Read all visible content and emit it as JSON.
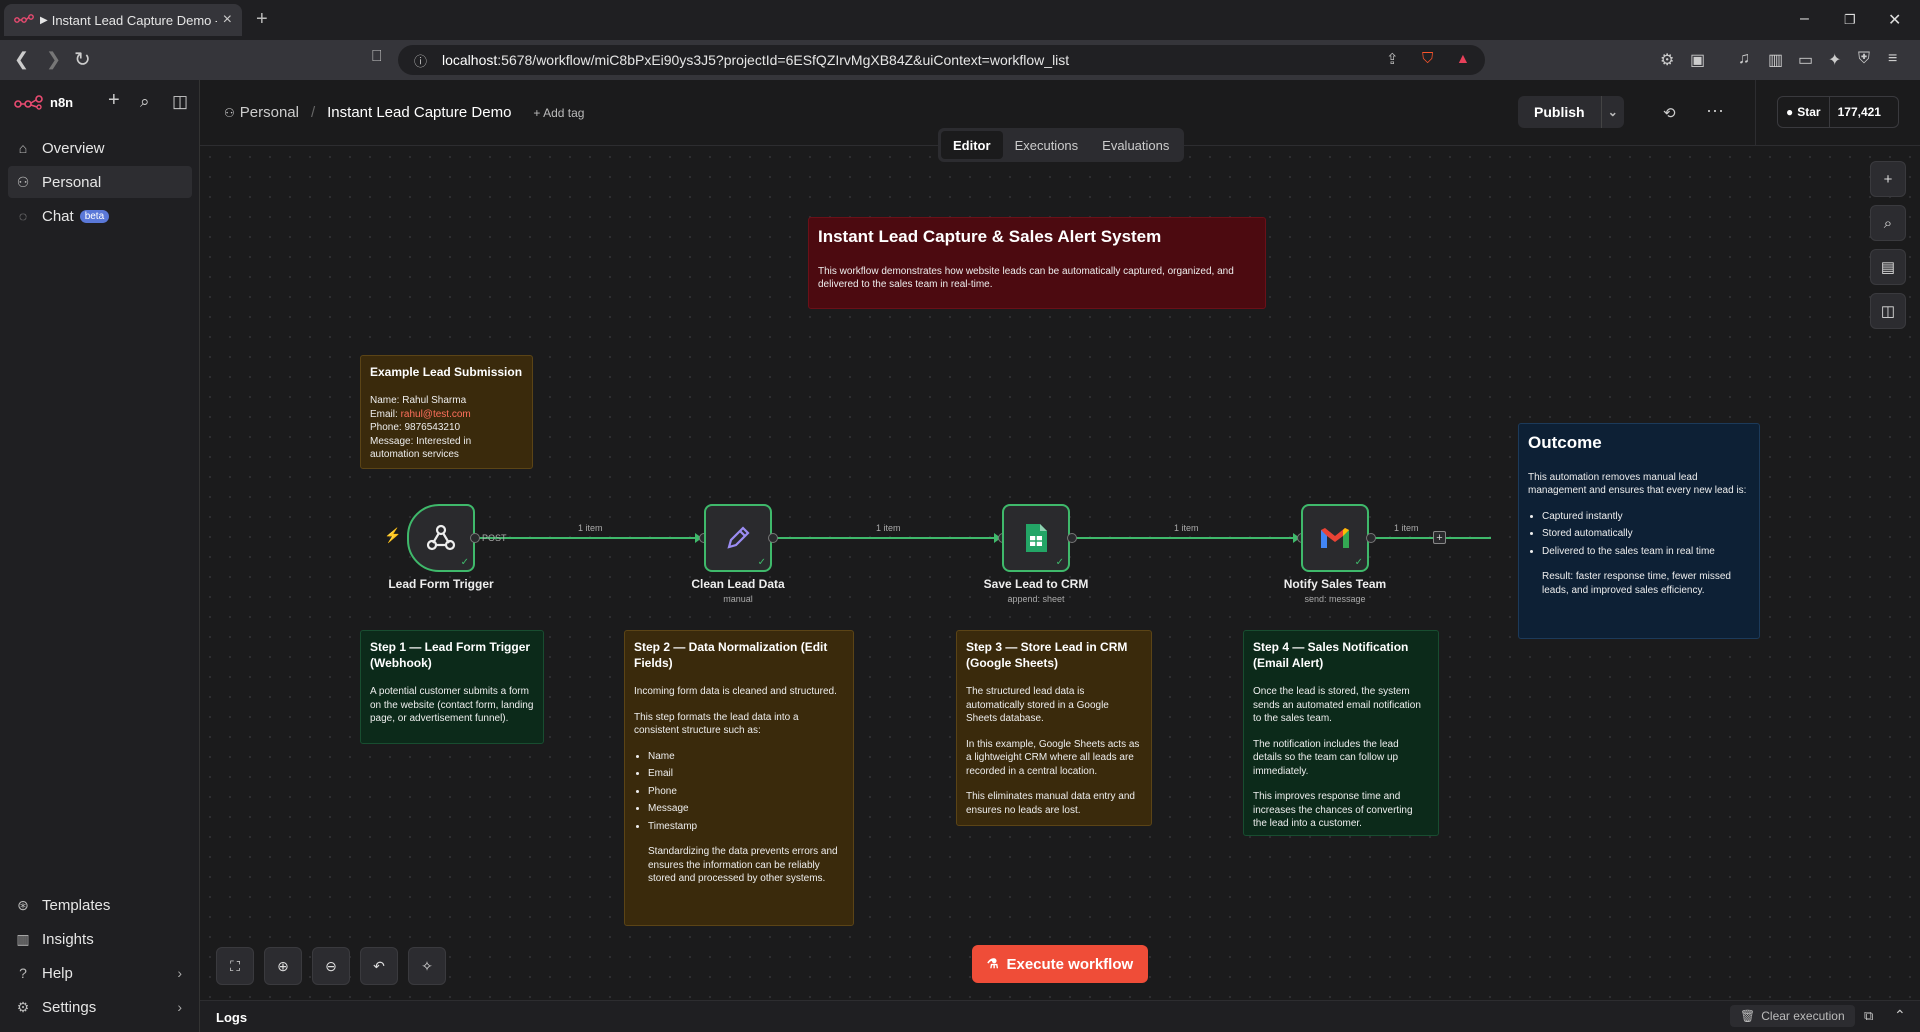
{
  "browser": {
    "tab_title": "Instant Lead Capture Demo - n",
    "url_host": "localhost",
    "url_rest": ":5678/workflow/miC8bPxEi90ys3J5?projectId=6ESfQZIrvMgXB84Z&uiContext=workflow_list"
  },
  "sidebar": {
    "logo": "n8n",
    "items": [
      {
        "label": "Overview",
        "icon": "home-icon"
      },
      {
        "label": "Personal",
        "icon": "user-icon"
      },
      {
        "label": "Chat",
        "icon": "chat-icon",
        "badge": "beta"
      }
    ],
    "bottom": [
      {
        "label": "Templates",
        "icon": "templates-icon"
      },
      {
        "label": "Insights",
        "icon": "chart-icon"
      },
      {
        "label": "Help",
        "icon": "help-icon"
      },
      {
        "label": "Settings",
        "icon": "gear-icon"
      }
    ]
  },
  "header": {
    "project": "Personal",
    "workflow_name": "Instant Lead Capture Demo",
    "add_tag": "+ Add tag",
    "publish": "Publish",
    "star": "Star",
    "star_count": "177,421",
    "tabs": [
      "Editor",
      "Executions",
      "Evaluations"
    ]
  },
  "notes": {
    "title": {
      "heading": "Instant Lead Capture & Sales Alert System",
      "body": "This workflow demonstrates how website leads can be automatically captured, organized, and delivered to the sales team in real-time."
    },
    "example": {
      "heading": "Example Lead Submission",
      "name": "Name: Rahul Sharma",
      "email_label": "Email: ",
      "email": "rahul@test.com",
      "phone": "Phone: 9876543210",
      "message": "Message: Interested in automation services"
    },
    "step1": {
      "heading": "Step 1 — Lead Form Trigger (Webhook)",
      "body": "A potential customer submits a form on the website (contact form, landing page, or advertisement funnel)."
    },
    "step2": {
      "heading": "Step 2 — Data Normalization (Edit Fields)",
      "p1": "Incoming form data is cleaned and structured.",
      "p2": "This step formats the lead data into a consistent structure such as:",
      "list": [
        "Name",
        "Email",
        "Phone",
        "Message",
        "Timestamp"
      ],
      "p3": "Standardizing the data prevents errors and ensures the information can be reliably stored and processed by other systems."
    },
    "step3": {
      "heading": "Step 3 — Store Lead in CRM (Google Sheets)",
      "p1": "The structured lead data is automatically stored in a Google Sheets database.",
      "p2": "In this example, Google Sheets acts as a lightweight CRM where all leads are recorded in a central location.",
      "p3": "This eliminates manual data entry and ensures no leads are lost."
    },
    "step4": {
      "heading": "Step 4 — Sales Notification (Email Alert)",
      "p1": "Once the lead is stored, the system sends an automated email notification to the sales team.",
      "p2": "The notification includes the lead details so the team can follow up immediately.",
      "p3": "This improves response time and increases the chances of converting the lead into a customer."
    },
    "outcome": {
      "heading": "Outcome",
      "p1": "This automation removes manual lead management and ensures that every new lead is:",
      "list": [
        "Captured instantly",
        "Stored automatically",
        "Delivered to the sales team in real time"
      ],
      "p2": "Result: faster response time, fewer missed leads, and improved sales efficiency."
    }
  },
  "nodes": [
    {
      "label": "Lead Form Trigger",
      "sub": "",
      "icon": "webhook-icon",
      "handle": "POST"
    },
    {
      "label": "Clean Lead Data",
      "sub": "manual",
      "icon": "pencil-icon"
    },
    {
      "label": "Save Lead to CRM",
      "sub": "append: sheet",
      "icon": "google-sheets-icon"
    },
    {
      "label": "Notify Sales Team",
      "sub": "send: message",
      "icon": "gmail-icon"
    }
  ],
  "connections": [
    "1 item",
    "1 item",
    "1 item",
    "1 item"
  ],
  "canvas": {
    "execute": "Execute workflow"
  },
  "logs": {
    "label": "Logs",
    "clear": "Clear execution"
  },
  "colors": {
    "accent": "#ef4d38",
    "success": "#3fb96b"
  }
}
